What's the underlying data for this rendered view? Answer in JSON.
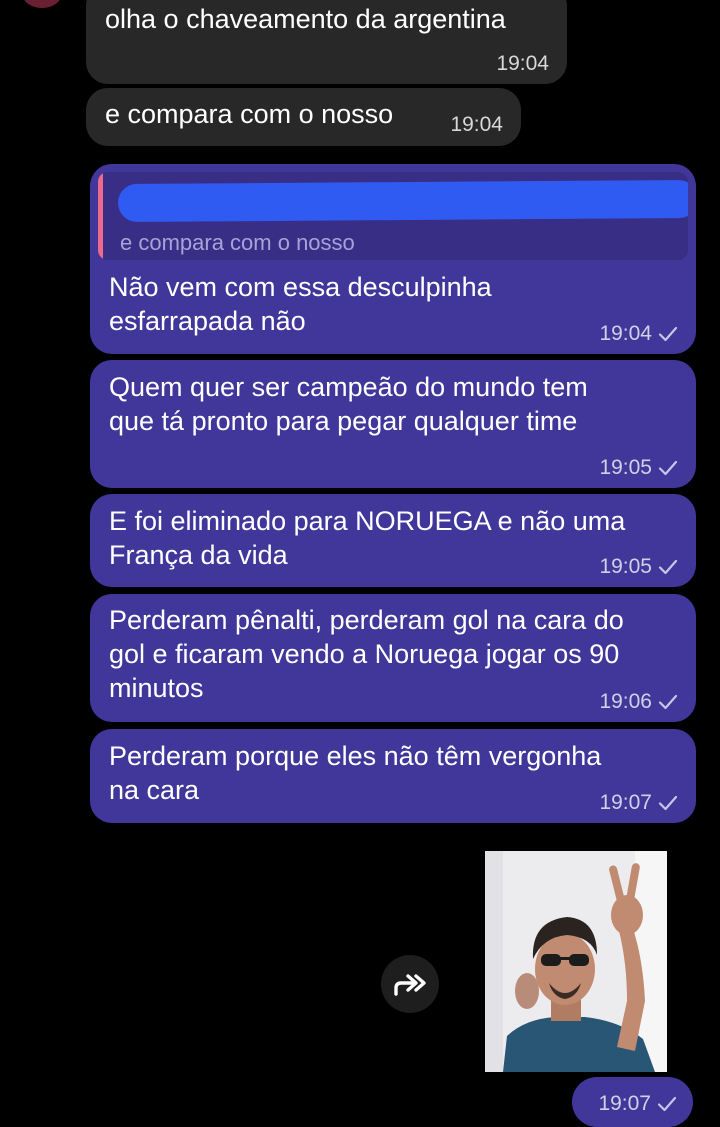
{
  "messages": [
    {
      "id": "m1",
      "direction": "incoming",
      "text": "olha o chaveamento da argentina",
      "time": "19:04"
    },
    {
      "id": "m2",
      "direction": "incoming",
      "text": "e compara com o nosso",
      "time": "19:04"
    },
    {
      "id": "m3",
      "direction": "outgoing",
      "reply_to": {
        "author": "",
        "text": "e compara com o nosso"
      },
      "text": "Não vem com essa desculpinha\nesfarrapada não",
      "time": "19:04"
    },
    {
      "id": "m4",
      "direction": "outgoing",
      "text": "Quem quer ser campeão do mundo tem\nque tá pronto para pegar qualquer time",
      "time": "19:05"
    },
    {
      "id": "m5",
      "direction": "outgoing",
      "text": "E foi eliminado para NORUEGA e não uma\nFrança da vida",
      "time": "19:05"
    },
    {
      "id": "m6",
      "direction": "outgoing",
      "text": "Perderam pênalti, perderam gol na cara do\ngol e ficaram vendo a Noruega jogar os 90\nminutos",
      "time": "19:06"
    },
    {
      "id": "m7",
      "direction": "outgoing",
      "text": "Perderam porque eles não têm vergonha\nna cara",
      "time": "19:07"
    },
    {
      "id": "m8",
      "direction": "outgoing",
      "type": "photo",
      "time": "19:07"
    }
  ],
  "icons": {
    "read_receipt": "check-icon",
    "forward": "forward-icon"
  },
  "colors": {
    "background": "#000000",
    "incoming_bubble": "#282828",
    "outgoing_bubble": "#41379b",
    "reply_bar": "#ee6a8b",
    "redaction": "#2f5bf3"
  }
}
